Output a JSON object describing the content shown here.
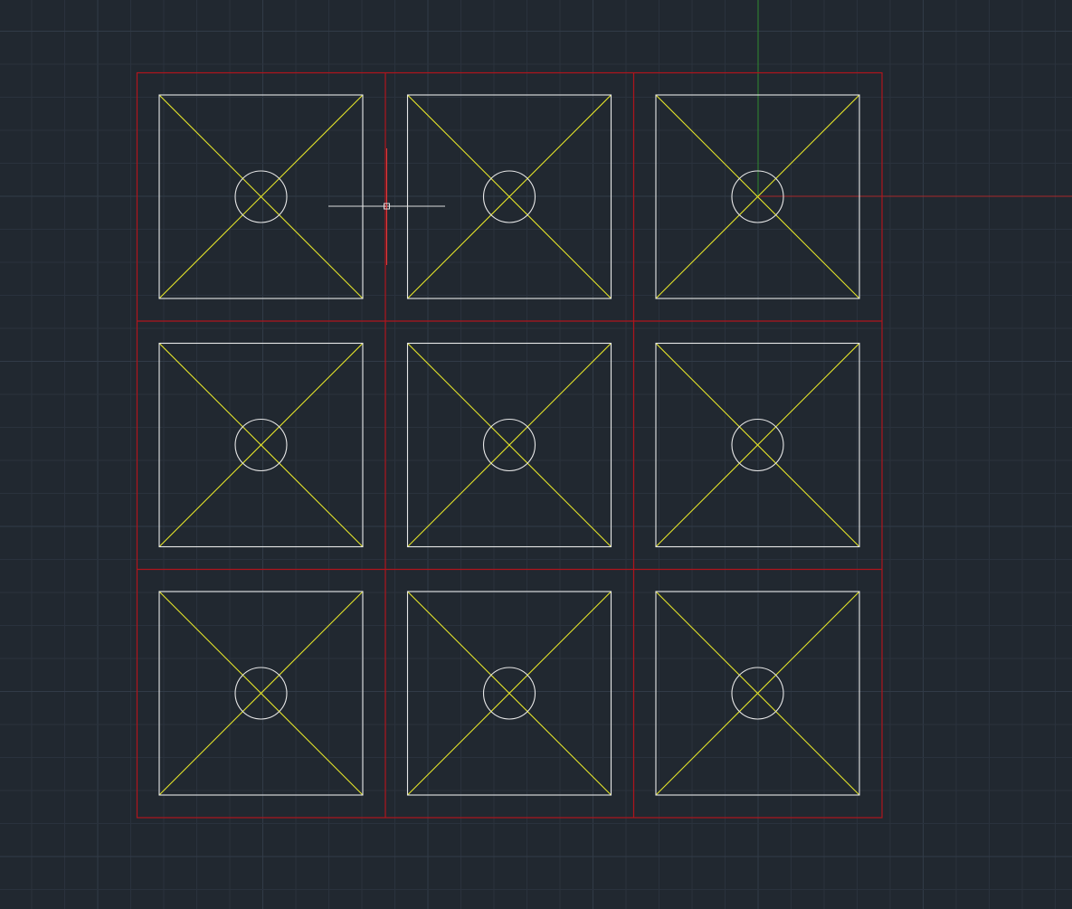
{
  "colors": {
    "background": "#212830",
    "grid_minor": "#2a323d",
    "grid_major": "#313b47",
    "frame_red": "#b0141c",
    "panel_white": "#e8e8e8",
    "diagonal_yellow": "#e6e62a",
    "axis_y_green": "#2f8a2f",
    "axis_x_red": "#a8282a",
    "crosshair_white": "#dcdcdc",
    "crosshair_red": "#e23a3a"
  },
  "icons": {
    "cursor": "crosshair-cursor-icon",
    "ucs_origin": "ucs-axis-icon"
  },
  "drawing": {
    "grid_rows": 3,
    "grid_cols": 3,
    "panel_shape": "square-with-x-diagonals-and-center-circle"
  }
}
